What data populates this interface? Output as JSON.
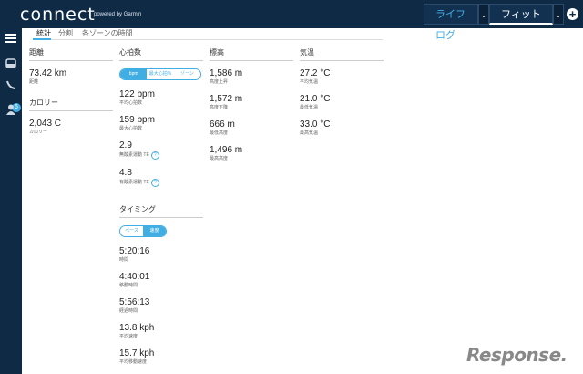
{
  "header": {
    "logo": "connect",
    "powered_by": "powered by Garmin",
    "tab_life": "ライフログ",
    "tab_fitness": "フィットネス",
    "dropdown": "⌄",
    "add": "+",
    "accent": "#41aee3",
    "bg": "#0f2a45"
  },
  "sidebar": {
    "badge": "6",
    "icons": [
      "menu-icon",
      "inbox-icon",
      "connections-icon",
      "profile-icon"
    ]
  },
  "tabs": [
    "統計",
    "分割",
    "各ゾーンの時間"
  ],
  "distance": {
    "title": "距離",
    "value": "73.42 km",
    "label": "距離"
  },
  "calories": {
    "title": "カロリー",
    "value": "2,043 C",
    "label": "カロリー"
  },
  "heartrate": {
    "title": "心拍数",
    "toggle": [
      "bpm",
      "最大心拍%",
      "ゾーン"
    ],
    "items": [
      {
        "value": "122 bpm",
        "label": "平均心拍数"
      },
      {
        "value": "159 bpm",
        "label": "最大心拍数"
      },
      {
        "value": "2.9",
        "label": "無酸素運動 TE"
      },
      {
        "value": "4.8",
        "label": "有酸素運動 TE"
      }
    ]
  },
  "timing": {
    "title": "タイミング",
    "toggle": [
      "ペース",
      "速度"
    ],
    "items": [
      {
        "value": "5:20:16",
        "label": "時間"
      },
      {
        "value": "4:40:01",
        "label": "移動時間"
      },
      {
        "value": "5:56:13",
        "label": "経過時間"
      },
      {
        "value": "13.8 kph",
        "label": "平均速度"
      },
      {
        "value": "15.7 kph",
        "label": "平均移動速度"
      }
    ]
  },
  "elevation": {
    "title": "標高",
    "items": [
      {
        "value": "1,586 m",
        "label": "高度上昇"
      },
      {
        "value": "1,572 m",
        "label": "高度下降"
      },
      {
        "value": "666 m",
        "label": "最低高度"
      },
      {
        "value": "1,496 m",
        "label": "最高高度"
      }
    ]
  },
  "temperature": {
    "title": "気温",
    "items": [
      {
        "value": "27.2 °C",
        "label": "平均気温"
      },
      {
        "value": "21.0 °C",
        "label": "最低気温"
      },
      {
        "value": "33.0 °C",
        "label": "最高気温"
      }
    ]
  },
  "watermark": "Response."
}
